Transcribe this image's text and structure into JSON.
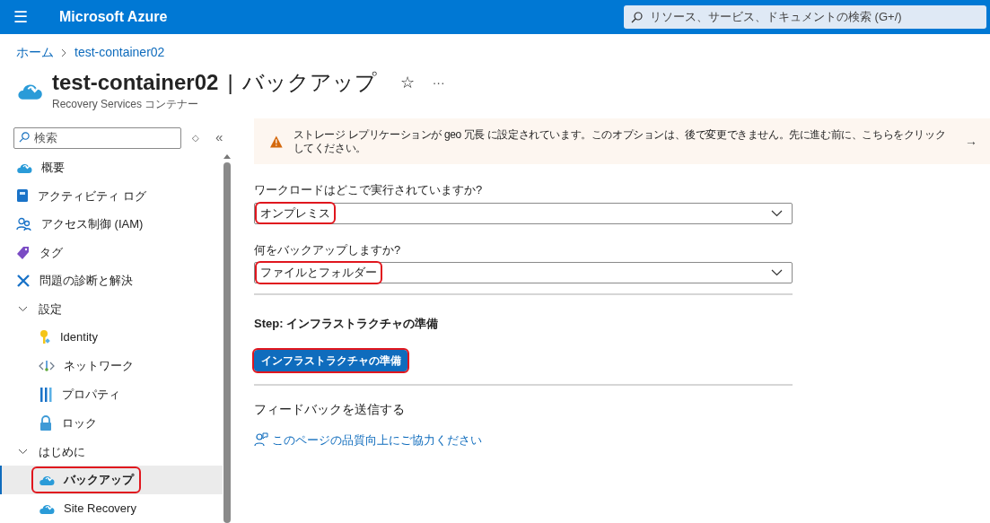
{
  "topbar": {
    "menu_glyph": "☰",
    "brand": "Microsoft Azure",
    "search": {
      "placeholder": "リソース、サービス、ドキュメントの検索 (G+/)"
    }
  },
  "breadcrumb": [
    "ホーム",
    "test-container02"
  ],
  "header": {
    "title": "test-container02",
    "separator": "|",
    "section": "バックアップ",
    "favorite_glyph": "☆",
    "more_glyph": "···",
    "subtitle": "Recovery Services コンテナー"
  },
  "sidebar": {
    "search": {
      "placeholder": "検索"
    },
    "sort_glyph": "◇",
    "collapse_glyph": "«",
    "items": [
      {
        "kind": "item",
        "label": "概要",
        "selected": false,
        "highlighted": false
      },
      {
        "kind": "item",
        "label": "アクティビティ ログ",
        "selected": false,
        "highlighted": false
      },
      {
        "kind": "item",
        "label": "アクセス制御 (IAM)",
        "selected": false,
        "highlighted": false
      },
      {
        "kind": "item",
        "label": "タグ",
        "selected": false,
        "highlighted": false
      },
      {
        "kind": "item",
        "label": "問題の診断と解決",
        "selected": false,
        "highlighted": false
      },
      {
        "kind": "group",
        "label": "設定",
        "expanded": true,
        "children": [
          {
            "label": "Identity",
            "selected": false,
            "highlighted": false
          },
          {
            "label": "ネットワーク",
            "selected": false,
            "highlighted": false
          },
          {
            "label": "プロパティ",
            "selected": false,
            "highlighted": false
          },
          {
            "label": "ロック",
            "selected": false,
            "highlighted": false
          }
        ]
      },
      {
        "kind": "group",
        "label": "はじめに",
        "expanded": true,
        "children": [
          {
            "label": "バックアップ",
            "selected": true,
            "highlighted": true
          },
          {
            "label": "Site Recovery",
            "selected": false,
            "highlighted": false
          }
        ]
      }
    ]
  },
  "banner": {
    "text": "ストレージ レプリケーションが geo 冗長 に設定されています。このオプションは、後で変更できません。先に進む前に、こちらをクリックしてください。",
    "arrow_glyph": "→"
  },
  "form": {
    "fields": [
      {
        "label": "ワークロードはどこで実行されていますか?",
        "value": "オンプレミス",
        "highlighted": true
      },
      {
        "label": "何をバックアップしますか?",
        "value": "ファイルとフォルダー",
        "highlighted": true
      }
    ],
    "step": "Step: インフラストラクチャの準備",
    "button": {
      "label": "インフラストラクチャの準備",
      "highlighted": true
    }
  },
  "feedback": {
    "heading": "フィードバックを送信する",
    "link": "このページの品質向上にご協力ください"
  }
}
